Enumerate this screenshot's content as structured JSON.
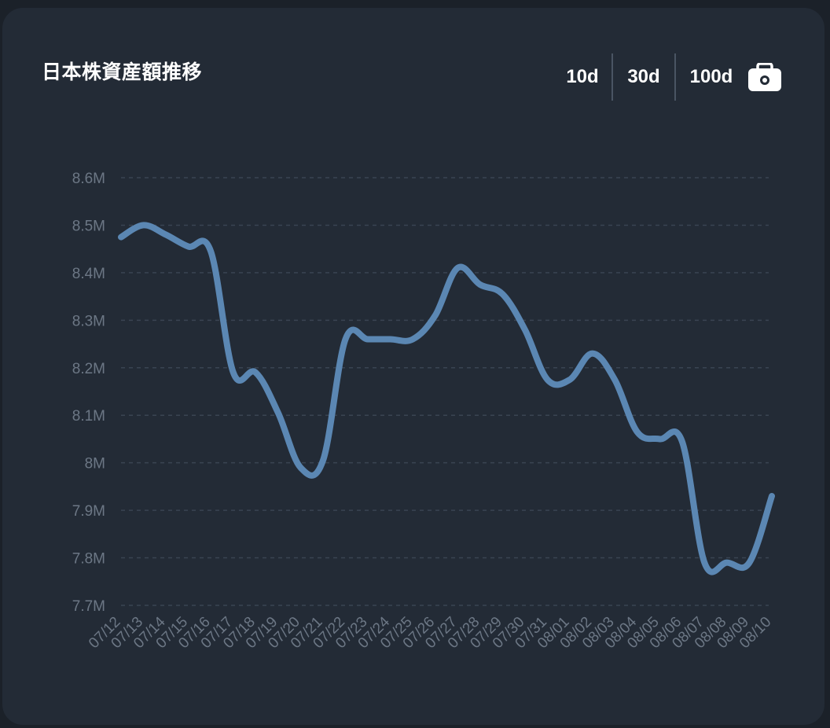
{
  "header": {
    "title": "日本株資産額推移",
    "ranges": [
      "10d",
      "30d",
      "100d"
    ],
    "camera_icon": "camera-icon"
  },
  "colors": {
    "background": "#232b36",
    "line": "#5b87b3",
    "grid": "#3a4452",
    "tick": "#6c7785",
    "title": "#ffffff"
  },
  "chart_data": {
    "type": "line",
    "title": "日本株資産額推移",
    "xlabel": "",
    "ylabel": "",
    "grid": true,
    "legend": "none",
    "ylim": [
      7700000,
      8600000
    ],
    "yticks": [
      7700000,
      7800000,
      7900000,
      8000000,
      8100000,
      8200000,
      8300000,
      8400000,
      8500000,
      8600000
    ],
    "ytick_labels": [
      "7.7M",
      "7.8M",
      "7.9M",
      "8M",
      "8.1M",
      "8.2M",
      "8.3M",
      "8.4M",
      "8.5M",
      "8.6M"
    ],
    "categories": [
      "07/12",
      "07/13",
      "07/14",
      "07/15",
      "07/16",
      "07/17",
      "07/18",
      "07/19",
      "07/20",
      "07/21",
      "07/22",
      "07/23",
      "07/24",
      "07/25",
      "07/26",
      "07/27",
      "07/28",
      "07/29",
      "07/30",
      "07/31",
      "08/01",
      "08/02",
      "08/03",
      "08/04",
      "08/05",
      "08/06",
      "08/07",
      "08/08",
      "08/09",
      "08/10"
    ],
    "series": [
      {
        "values": [
          8475000,
          8500000,
          8480000,
          8455000,
          8445000,
          8190000,
          8190000,
          8105000,
          7990000,
          8005000,
          8260000,
          8260000,
          8260000,
          8260000,
          8310000,
          8410000,
          8375000,
          8355000,
          8280000,
          8175000,
          8175000,
          8230000,
          8175000,
          8065000,
          8050000,
          8045000,
          7790000,
          7790000,
          7790000,
          7930000
        ]
      }
    ]
  }
}
